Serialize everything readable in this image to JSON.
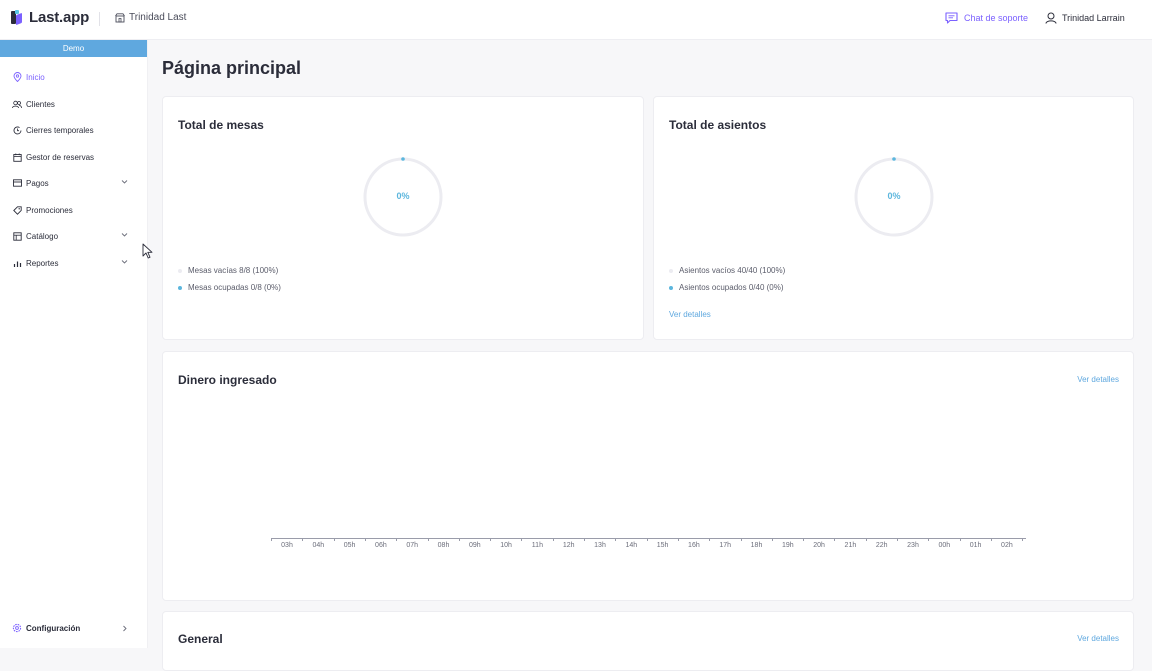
{
  "header": {
    "logo_text": "Last.app",
    "restaurant": "Trinidad Last",
    "support_label": "Chat de soporte",
    "user_name": "Trinidad Larrain"
  },
  "sidebar": {
    "demo_label": "Demo",
    "items": [
      {
        "label": "Inicio",
        "icon": "location-pin-icon",
        "active": true
      },
      {
        "label": "Clientes",
        "icon": "users-icon"
      },
      {
        "label": "Cierres temporales",
        "icon": "clock-icon"
      },
      {
        "label": "Gestor de reservas",
        "icon": "calendar-icon"
      },
      {
        "label": "Pagos",
        "icon": "card-icon",
        "expandable": true
      },
      {
        "label": "Promociones",
        "icon": "tag-icon"
      },
      {
        "label": "Catálogo",
        "icon": "book-icon",
        "expandable": true
      },
      {
        "label": "Reportes",
        "icon": "chart-icon",
        "expandable": true
      }
    ],
    "config_label": "Configuración"
  },
  "main": {
    "title": "Página principal",
    "mesas": {
      "title": "Total de mesas",
      "percent": "0%",
      "fill_fraction": 0,
      "legend": [
        "Mesas vacías 8/8 (100%)",
        "Mesas ocupadas 0/8 (0%)"
      ]
    },
    "asientos": {
      "title": "Total de asientos",
      "percent": "0%",
      "fill_fraction": 0,
      "legend": [
        "Asientos vacíos 40/40 (100%)",
        "Asientos ocupados 0/40 (0%)"
      ],
      "link": "Ver detalles"
    },
    "dinero": {
      "title": "Dinero ingresado",
      "link": "Ver detalles",
      "hours": [
        "03h",
        "04h",
        "05h",
        "06h",
        "07h",
        "08h",
        "09h",
        "10h",
        "11h",
        "12h",
        "13h",
        "14h",
        "15h",
        "16h",
        "17h",
        "18h",
        "19h",
        "20h",
        "21h",
        "22h",
        "23h",
        "00h",
        "01h",
        "02h"
      ]
    },
    "general": {
      "title": "General",
      "link": "Ver detalles"
    }
  },
  "colors": {
    "accent_purple": "#7b61ff",
    "accent_blue": "#5cb6dd",
    "demo_bar": "#5fa8df"
  }
}
